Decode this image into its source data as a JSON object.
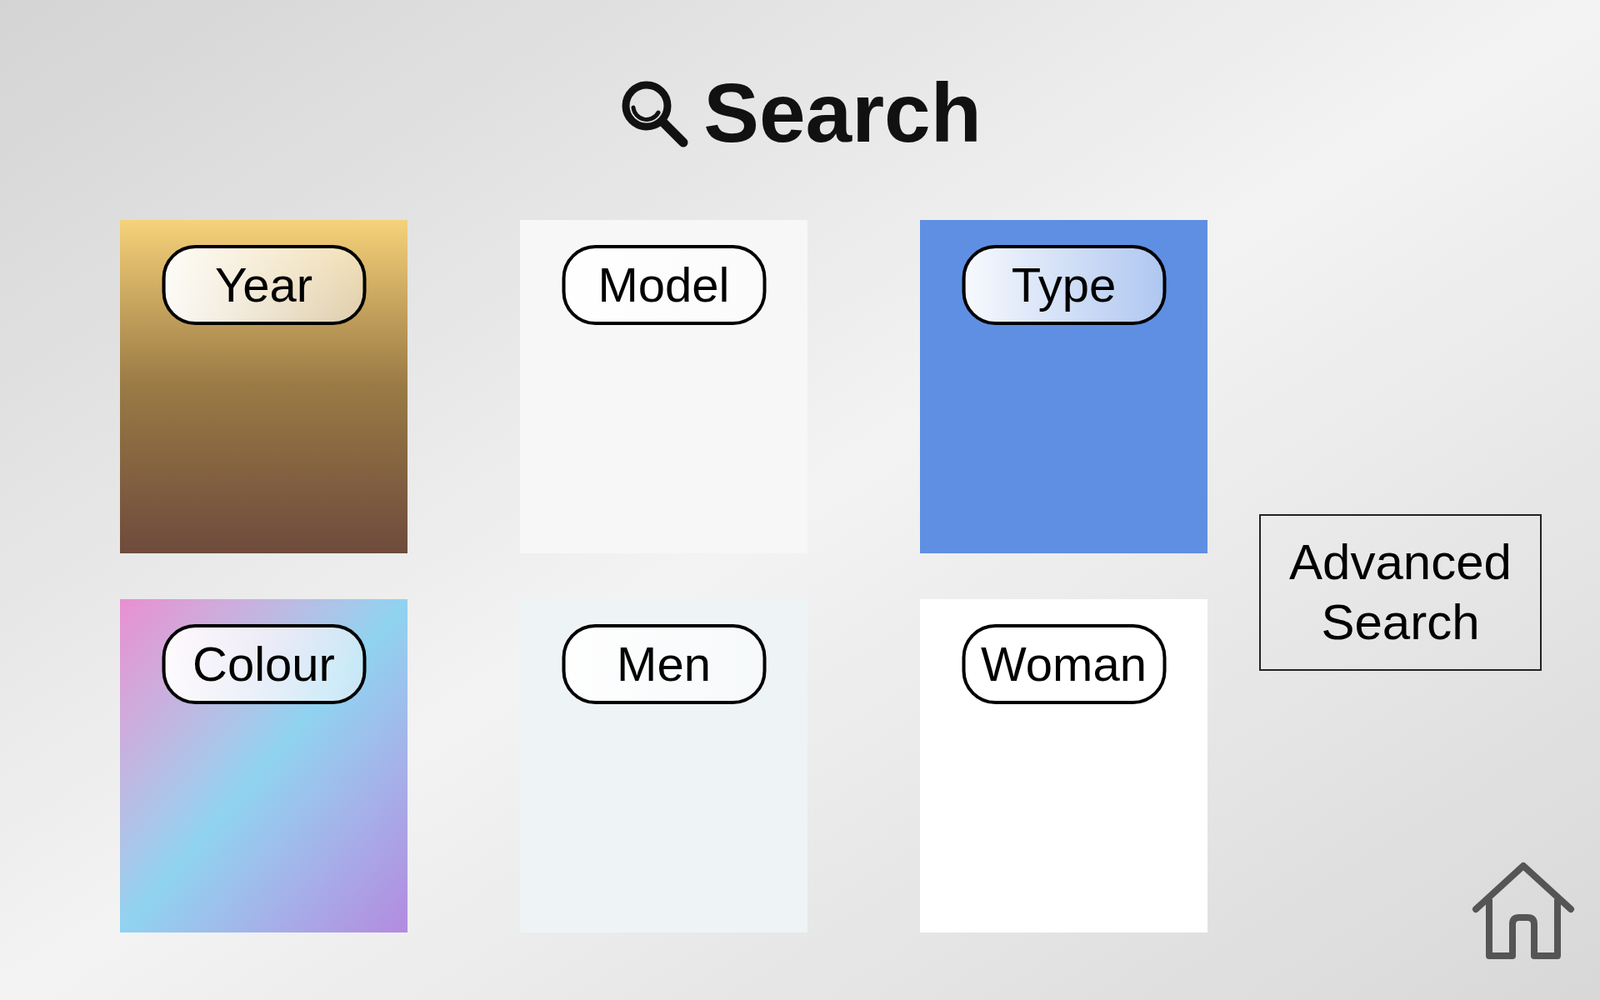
{
  "title": "Search",
  "tiles": [
    {
      "label": "Year"
    },
    {
      "label": "Model"
    },
    {
      "label": "Type"
    },
    {
      "label": "Colour"
    },
    {
      "label": "Men"
    },
    {
      "label": "Woman"
    }
  ],
  "advanced_search": {
    "label": "Advanced Search"
  }
}
